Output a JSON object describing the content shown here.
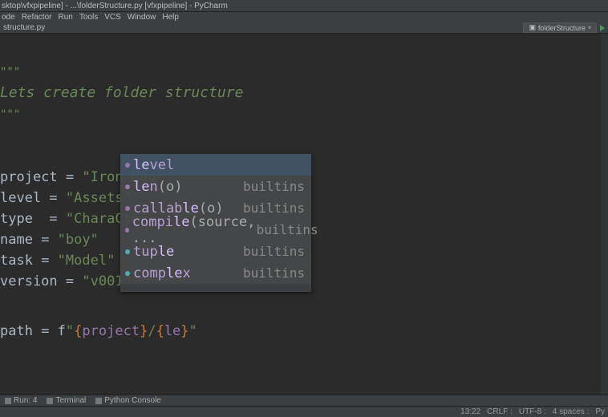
{
  "title": "sktop\\vfxpipeline] - ...\\folderStructure.py [vfxpipeline] - PyCharm",
  "menus": [
    "ode",
    "Refactor",
    "Run",
    "Tools",
    "VCS",
    "Window",
    "Help"
  ],
  "breadcrumb": "structure.py",
  "runConfig": "folderStructure",
  "code": {
    "doc1": "\"\"\"",
    "docline": "Lets create folder structure",
    "doc2": "\"\"\"",
    "l1_var": "project",
    "l1_op": " = ",
    "l1_str": "\"Iron Man\"",
    "l2_var": "level",
    "l2_op": " = ",
    "l2_str": "\"Assets\"",
    "l3_var": "type",
    "l3_op": "  = ",
    "l3_str": "\"CharaCte",
    "l4_var": "name",
    "l4_op": " = ",
    "l4_str": "\"boy\"",
    "l5_var": "task",
    "l5_op": " = ",
    "l5_str": "\"Model\"",
    "l6_var": "version",
    "l6_op": " = ",
    "l6_str": "\"v001\"",
    "path_var": "path",
    "path_op": " = f",
    "path_q1": "\"",
    "path_b1": "{",
    "path_v1": "project",
    "path_b2": "}",
    "path_slash": "/",
    "path_b3": "{",
    "path_v2": "le",
    "path_b4": "}",
    "path_q2": "\""
  },
  "autocomplete": [
    {
      "pre": "le",
      "rest": "vel",
      "type": "",
      "dot": "purple"
    },
    {
      "pre": "le",
      "rest": "n",
      "paren": "(o)",
      "type": "builtins",
      "dot": "purple"
    },
    {
      "pre": "",
      "rest": "callab",
      "mid": "le",
      "paren": "(o)",
      "type": "builtins",
      "dot": "purple"
    },
    {
      "pre": "",
      "rest": "compi",
      "mid": "le",
      "paren": "(source, ...",
      "type": "builtins",
      "dot": "purple"
    },
    {
      "pre": "",
      "rest": "tup",
      "mid": "le",
      "type": "builtins",
      "dot": "cyan"
    },
    {
      "pre": "",
      "rest": "comp",
      "mid": "le",
      "after": "x",
      "type": "builtins",
      "dot": "cyan"
    }
  ],
  "footerTools": [
    "Run: 4",
    "Terminal",
    "Python Console"
  ],
  "status": {
    "left": "",
    "right": [
      "13:22",
      "CRLF :",
      "UTF-8 :",
      "4 spaces :",
      "Py"
    ]
  },
  "ac_footer_hint": ""
}
